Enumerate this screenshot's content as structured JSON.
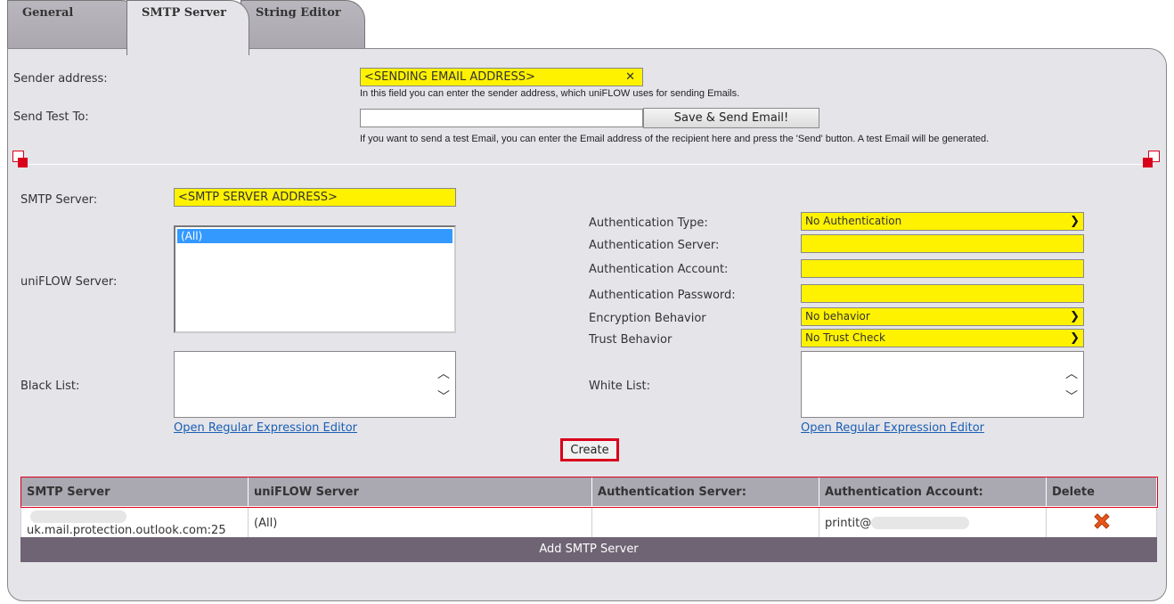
{
  "tabs": [
    {
      "label": "General"
    },
    {
      "label": "SMTP Server"
    },
    {
      "label": "String Editor"
    }
  ],
  "sender": {
    "label": "Sender address:",
    "value": "<SENDING EMAIL ADDRESS>",
    "hint": "In this field you can enter the sender address, which uniFLOW uses for sending Emails."
  },
  "test": {
    "label": "Send Test To:",
    "value": "",
    "button": "Save & Send Email!",
    "hint": "If you want to send a test Email, you can enter the Email address of the recipient here and press the 'Send' button. A test Email will be generated."
  },
  "smtp": {
    "server_label": "SMTP Server:",
    "server_value": "<SMTP SERVER ADDRESS>",
    "uniflow_label": "uniFLOW Server:",
    "uniflow_options": [
      "(All)"
    ],
    "blacklist_label": "Black List:",
    "whitelist_label": "White List:",
    "regex_link": "Open Regular Expression Editor",
    "create_button": "Create"
  },
  "auth": {
    "type_label": "Authentication Type:",
    "type_value": "No Authentication",
    "server_label": "Authentication Server:",
    "account_label": "Authentication Account:",
    "password_label": "Authentication Password:",
    "encryption_label": "Encryption Behavior",
    "encryption_value": "No behavior",
    "trust_label": "Trust Behavior",
    "trust_value": "No Trust Check"
  },
  "table": {
    "headers": [
      "SMTP Server",
      "uniFLOW Server",
      "Authentication Server:",
      "Authentication Account:",
      "Delete"
    ],
    "rows": [
      {
        "smtp": "uk.mail.protection.outlook.com:25",
        "uniflow": "(All)",
        "auth_server": "",
        "auth_account": "printit@"
      }
    ],
    "add_label": "Add SMTP Server"
  },
  "colors": {
    "highlight": "#fff200",
    "accent": "#d9001b",
    "header": "#aaa8b1",
    "addrow": "#6e6474"
  }
}
